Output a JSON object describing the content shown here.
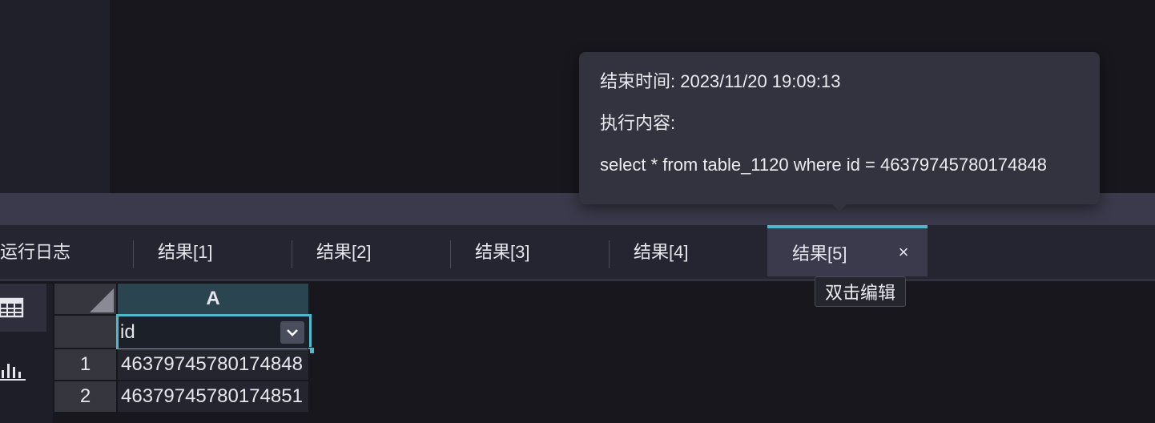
{
  "popover": {
    "end_time": "结束时间: 2023/11/20 19:09:13",
    "exec_label": "执行内容:",
    "sql": "select * from table_1120 where id = 46379745780174848"
  },
  "tabs": [
    {
      "label": "运行日志",
      "active": false
    },
    {
      "label": "结果[1]",
      "active": false
    },
    {
      "label": "结果[2]",
      "active": false
    },
    {
      "label": "结果[3]",
      "active": false
    },
    {
      "label": "结果[4]",
      "active": false
    },
    {
      "label": "结果[5]",
      "active": true,
      "close": "×"
    }
  ],
  "tooltip": "双击编辑",
  "side_icons": [
    {
      "name": "table-view-icon",
      "active": true
    },
    {
      "name": "bar-chart-icon",
      "active": false
    }
  ],
  "grid": {
    "column_header": "A",
    "header_field": "id",
    "rows": [
      {
        "num": "1",
        "value": "46379745780174848"
      },
      {
        "num": "2",
        "value": "46379745780174851"
      }
    ]
  },
  "colors": {
    "accent": "#4fb8cc",
    "background": "#17171d",
    "tab_active": "#3a3a4c"
  }
}
